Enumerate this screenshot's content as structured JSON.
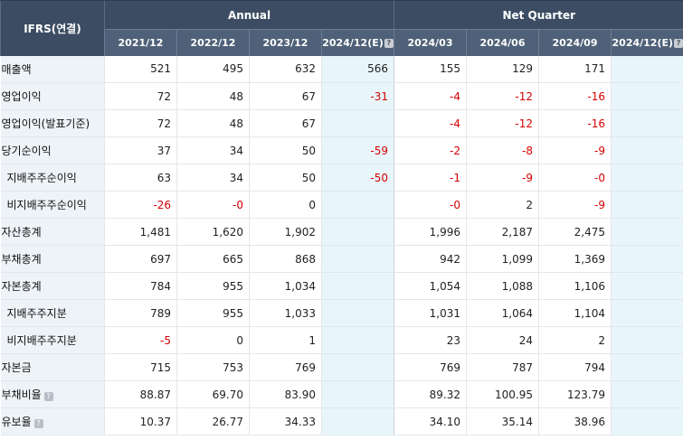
{
  "header": {
    "corner_label": "IFRS(연결)",
    "group_annual": "Annual",
    "group_quarter": "Net Quarter",
    "estimate_info_icon": "question-mark-icon",
    "annual_periods": [
      "2021/12",
      "2022/12",
      "2023/12",
      "2024/12(E)"
    ],
    "quarter_periods": [
      "2024/03",
      "2024/06",
      "2024/09",
      "2024/12(E)"
    ]
  },
  "colors": {
    "header_dark": "#3c4d63",
    "header_light": "#4f6178",
    "label_bg": "#eef3f8",
    "estimate_bg": "#e8f6fb",
    "negative": "#d60000"
  },
  "rows": [
    {
      "label": "매출액",
      "sub": false,
      "info": false,
      "annual": [
        "521",
        "495",
        "632",
        "566"
      ],
      "quarter": [
        "155",
        "129",
        "171",
        ""
      ]
    },
    {
      "label": "영업이익",
      "sub": false,
      "info": false,
      "annual": [
        "72",
        "48",
        "67",
        "-31"
      ],
      "quarter": [
        "-4",
        "-12",
        "-16",
        ""
      ]
    },
    {
      "label": "영업이익(발표기준)",
      "sub": false,
      "info": false,
      "annual": [
        "72",
        "48",
        "67",
        ""
      ],
      "quarter": [
        "-4",
        "-12",
        "-16",
        ""
      ]
    },
    {
      "label": "당기순이익",
      "sub": false,
      "info": false,
      "annual": [
        "37",
        "34",
        "50",
        "-59"
      ],
      "quarter": [
        "-2",
        "-8",
        "-9",
        ""
      ]
    },
    {
      "label": "지배주주순이익",
      "sub": true,
      "info": false,
      "annual": [
        "63",
        "34",
        "50",
        "-50"
      ],
      "quarter": [
        "-1",
        "-9",
        "-0",
        ""
      ]
    },
    {
      "label": "비지배주주순이익",
      "sub": true,
      "info": false,
      "annual": [
        "-26",
        "-0",
        "0",
        ""
      ],
      "quarter": [
        "-0",
        "2",
        "-9",
        ""
      ]
    },
    {
      "label": "자산총계",
      "sub": false,
      "info": false,
      "annual": [
        "1,481",
        "1,620",
        "1,902",
        ""
      ],
      "quarter": [
        "1,996",
        "2,187",
        "2,475",
        ""
      ]
    },
    {
      "label": "부채총계",
      "sub": false,
      "info": false,
      "annual": [
        "697",
        "665",
        "868",
        ""
      ],
      "quarter": [
        "942",
        "1,099",
        "1,369",
        ""
      ]
    },
    {
      "label": "자본총계",
      "sub": false,
      "info": false,
      "annual": [
        "784",
        "955",
        "1,034",
        ""
      ],
      "quarter": [
        "1,054",
        "1,088",
        "1,106",
        ""
      ]
    },
    {
      "label": "지배주주지분",
      "sub": true,
      "info": false,
      "annual": [
        "789",
        "955",
        "1,033",
        ""
      ],
      "quarter": [
        "1,031",
        "1,064",
        "1,104",
        ""
      ]
    },
    {
      "label": "비지배주주지분",
      "sub": true,
      "info": false,
      "annual": [
        "-5",
        "0",
        "1",
        ""
      ],
      "quarter": [
        "23",
        "24",
        "2",
        ""
      ]
    },
    {
      "label": "자본금",
      "sub": false,
      "info": false,
      "annual": [
        "715",
        "753",
        "769",
        ""
      ],
      "quarter": [
        "769",
        "787",
        "794",
        ""
      ]
    },
    {
      "label": "부채비율",
      "sub": false,
      "info": true,
      "annual": [
        "88.87",
        "69.70",
        "83.90",
        ""
      ],
      "quarter": [
        "89.32",
        "100.95",
        "123.79",
        ""
      ]
    },
    {
      "label": "유보율",
      "sub": false,
      "info": true,
      "annual": [
        "10.37",
        "26.77",
        "34.33",
        ""
      ],
      "quarter": [
        "34.10",
        "35.14",
        "38.96",
        ""
      ]
    }
  ]
}
